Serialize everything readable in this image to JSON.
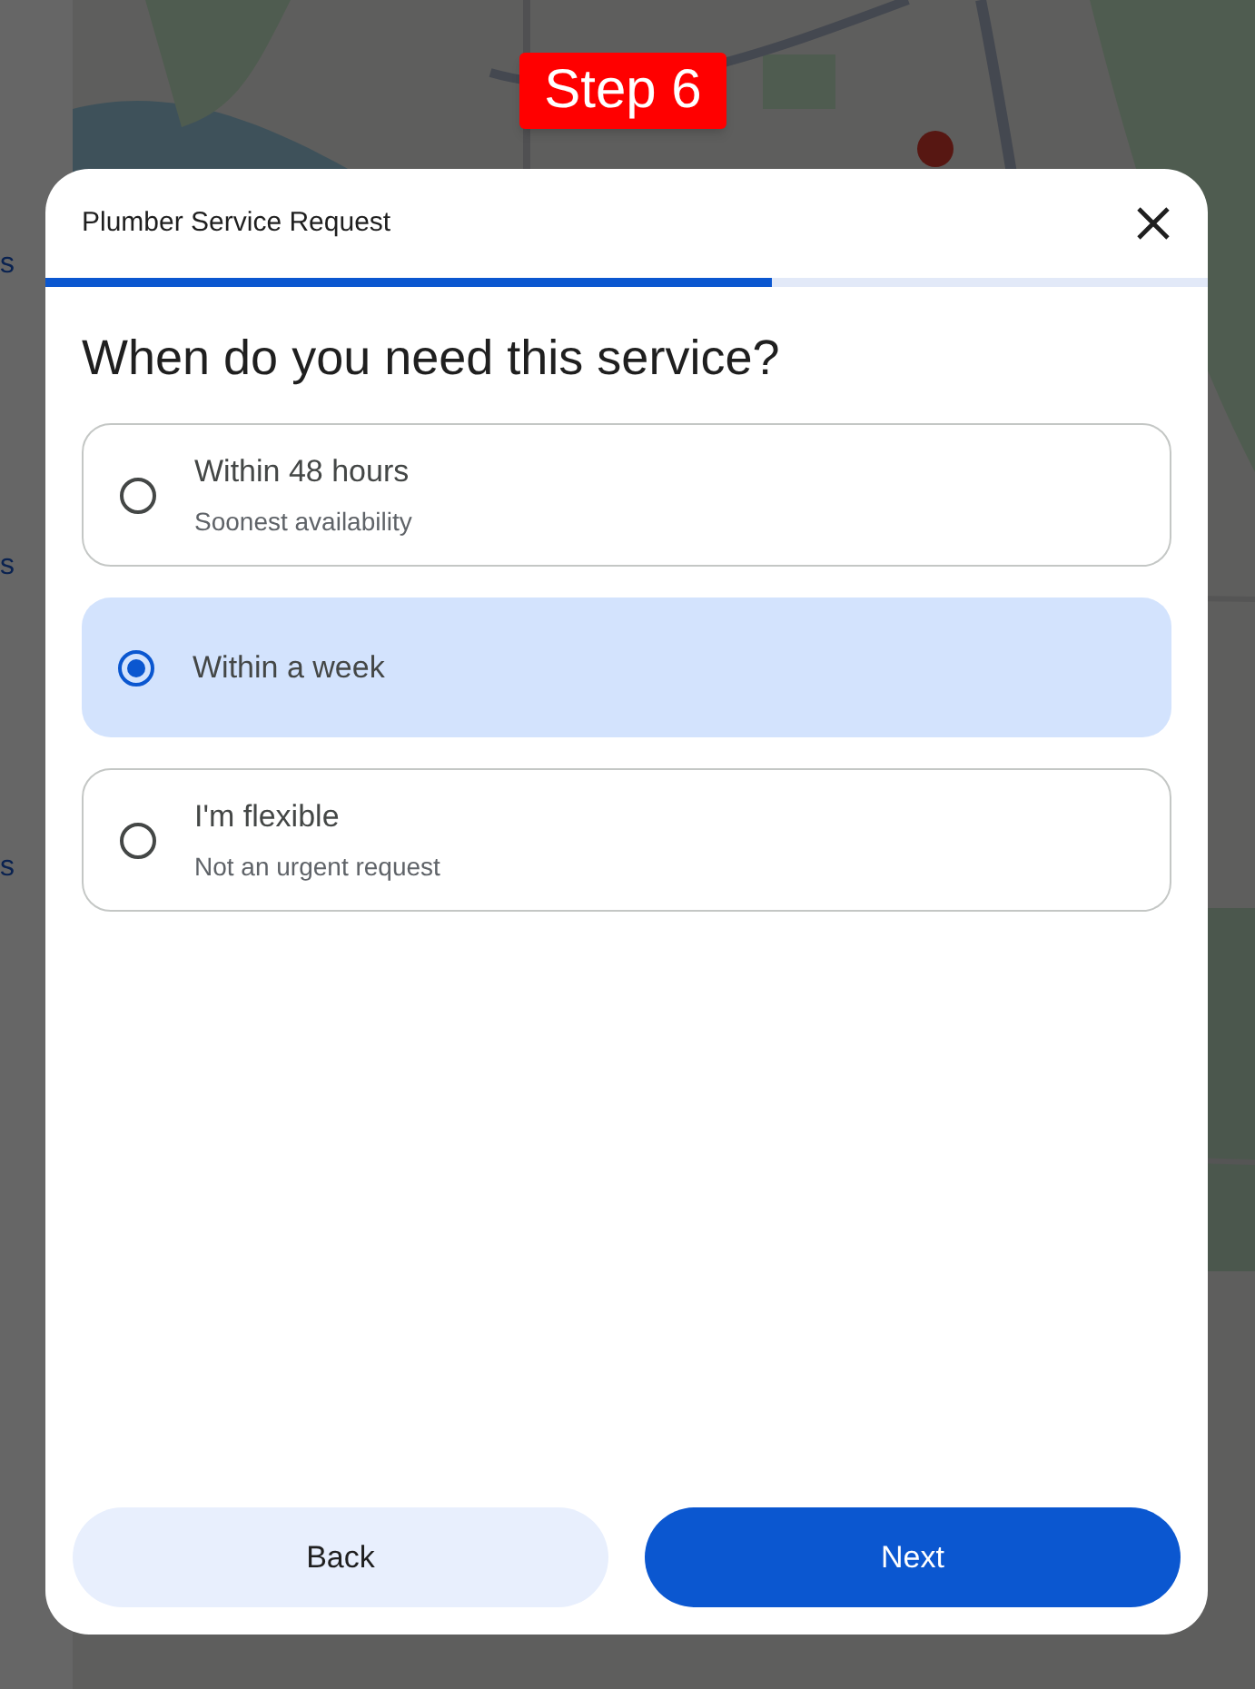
{
  "sidebar": {
    "items": [
      "s",
      "s",
      "s"
    ]
  },
  "step_badge": "Step 6",
  "dialog": {
    "title": "Plumber Service Request",
    "progress": {
      "level": 0.625
    },
    "question": "When do you need this service?",
    "options": [
      {
        "label": "Within 48 hours",
        "description": "Soonest availability",
        "selected": false
      },
      {
        "label": "Within a week",
        "selected": true
      },
      {
        "label": "I'm flexible",
        "description": "Not an urgent request",
        "selected": false
      }
    ],
    "buttons": [
      {
        "label": "Back",
        "kind": "secondary"
      },
      {
        "label": "Next",
        "kind": "primary"
      }
    ]
  }
}
